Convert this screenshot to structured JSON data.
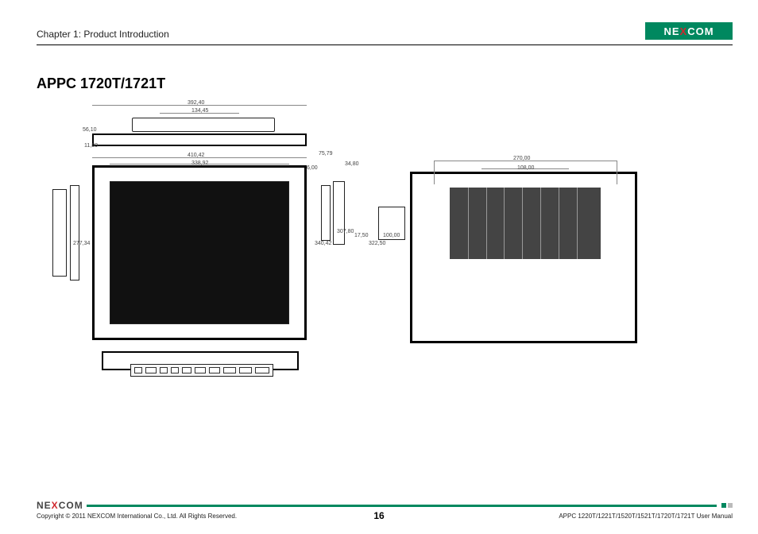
{
  "header": {
    "chapter": "Chapter 1: Product Introduction",
    "brand": "NEXCOM"
  },
  "title": "APPC 1720T/1721T",
  "dimensions": {
    "d1": "392,40",
    "d2": "134,45",
    "d3": "56,10",
    "d4": "11,80",
    "d5": "410,42",
    "d6": "338,92",
    "d7": "75,79",
    "d8": "34,80",
    "d9": "6,00",
    "d10": "277,34",
    "d11": "340,42",
    "d12": "307,80",
    "d13": "17,50",
    "d14": "322,50",
    "d15": "270,00",
    "d16": "108,00",
    "d17": "100,00"
  },
  "footer": {
    "copyright": "Copyright © 2011 NEXCOM International Co., Ltd. All Rights Reserved.",
    "page": "16",
    "manual": "APPC 1220T/1221T/1520T/1521T/1720T/1721T User Manual"
  }
}
